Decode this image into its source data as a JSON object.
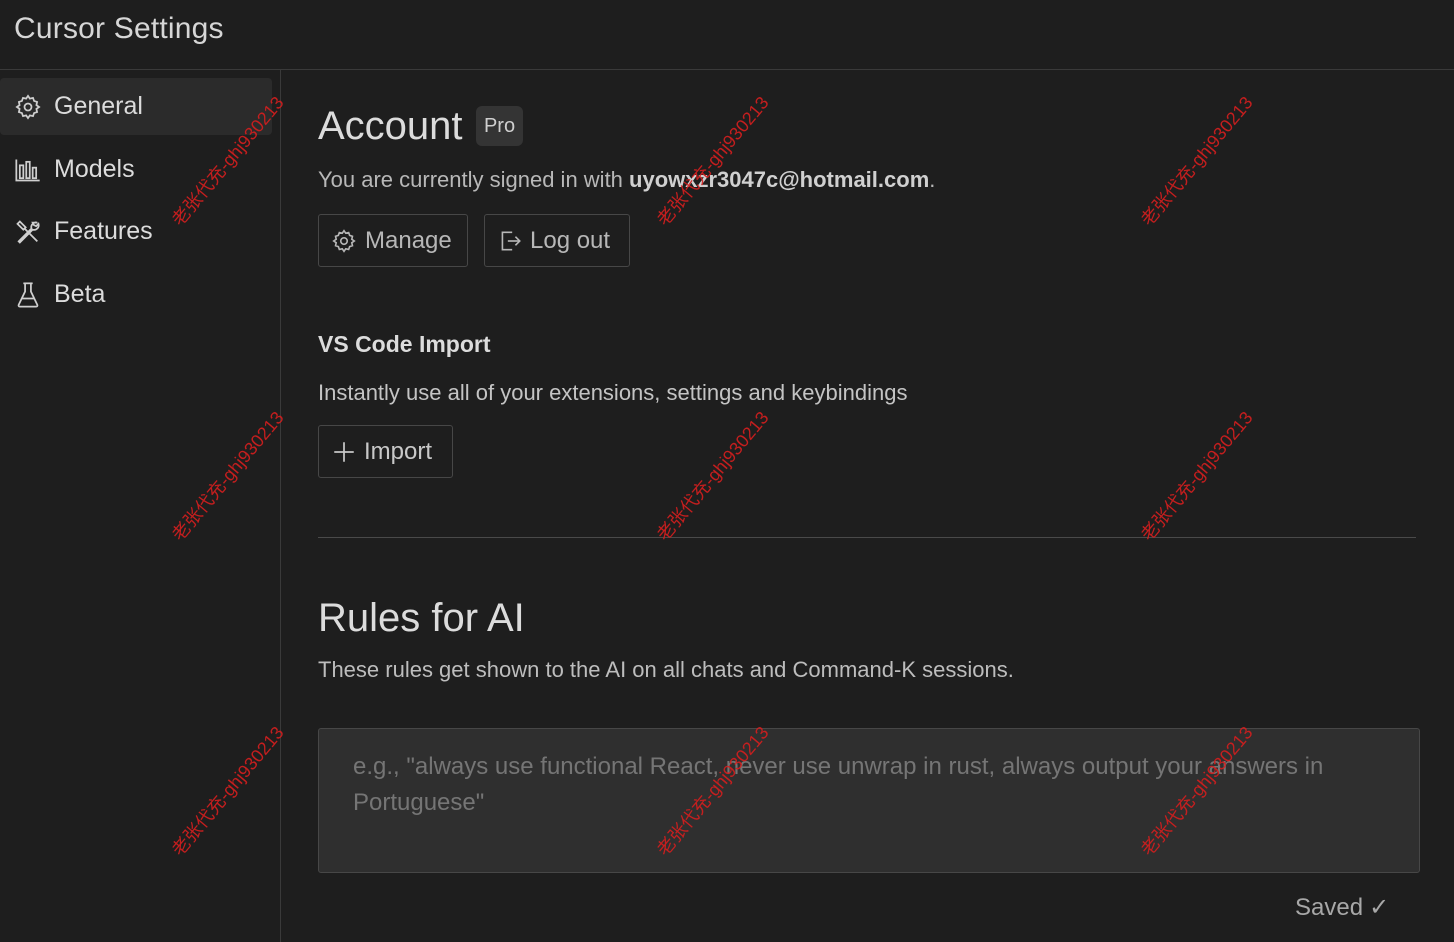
{
  "window": {
    "title": "Cursor Settings"
  },
  "sidebar": {
    "items": [
      {
        "label": "General",
        "icon": "gear-icon",
        "active": true
      },
      {
        "label": "Models",
        "icon": "bar-chart-icon",
        "active": false
      },
      {
        "label": "Features",
        "icon": "tools-icon",
        "active": false
      },
      {
        "label": "Beta",
        "icon": "flask-icon",
        "active": false
      }
    ]
  },
  "account": {
    "heading": "Account",
    "plan_badge": "Pro",
    "signed_in_prefix": "You are currently signed in with ",
    "email": "uyowxzr3047c@hotmail.com",
    "signed_in_suffix": ".",
    "manage_label": "Manage",
    "logout_label": "Log out"
  },
  "vscode_import": {
    "heading": "VS Code Import",
    "description": "Instantly use all of your extensions, settings and keybindings",
    "import_label": "Import"
  },
  "rules_for_ai": {
    "heading": "Rules for AI",
    "description": "These rules get shown to the AI on all chats and Command-K sessions.",
    "placeholder": "e.g., \"always use functional React, never use unwrap in rust, always output your answers in Portuguese\"",
    "value": "",
    "status": "Saved",
    "status_icon": "check-icon"
  },
  "watermark": {
    "text": "老张代充-ghj930213",
    "color": "#d61e1e"
  },
  "colors": {
    "background": "#1e1e1e",
    "border": "#3a3a3a",
    "input_bg": "#2f2f2f",
    "active_nav": "#2b2b2b"
  }
}
